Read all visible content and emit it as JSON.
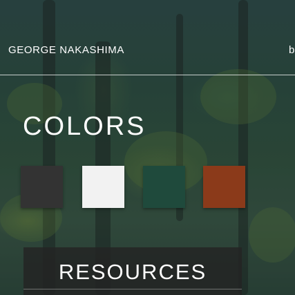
{
  "header": {
    "brand": "GEORGE NAKASHIMA",
    "nav_peek": "b"
  },
  "colors_section": {
    "title": "COLORS",
    "swatches": [
      {
        "name": "charcoal",
        "hex": "#333333"
      },
      {
        "name": "white",
        "hex": "#f2f2f2"
      },
      {
        "name": "forest-green",
        "hex": "#1f4a3c"
      },
      {
        "name": "rust",
        "hex": "#8b3a1a"
      }
    ]
  },
  "resources": {
    "label": "RESOURCES"
  },
  "theme": {
    "divider_color": "#ffffff",
    "text_color": "#ffffff",
    "button_bg": "#232323"
  }
}
